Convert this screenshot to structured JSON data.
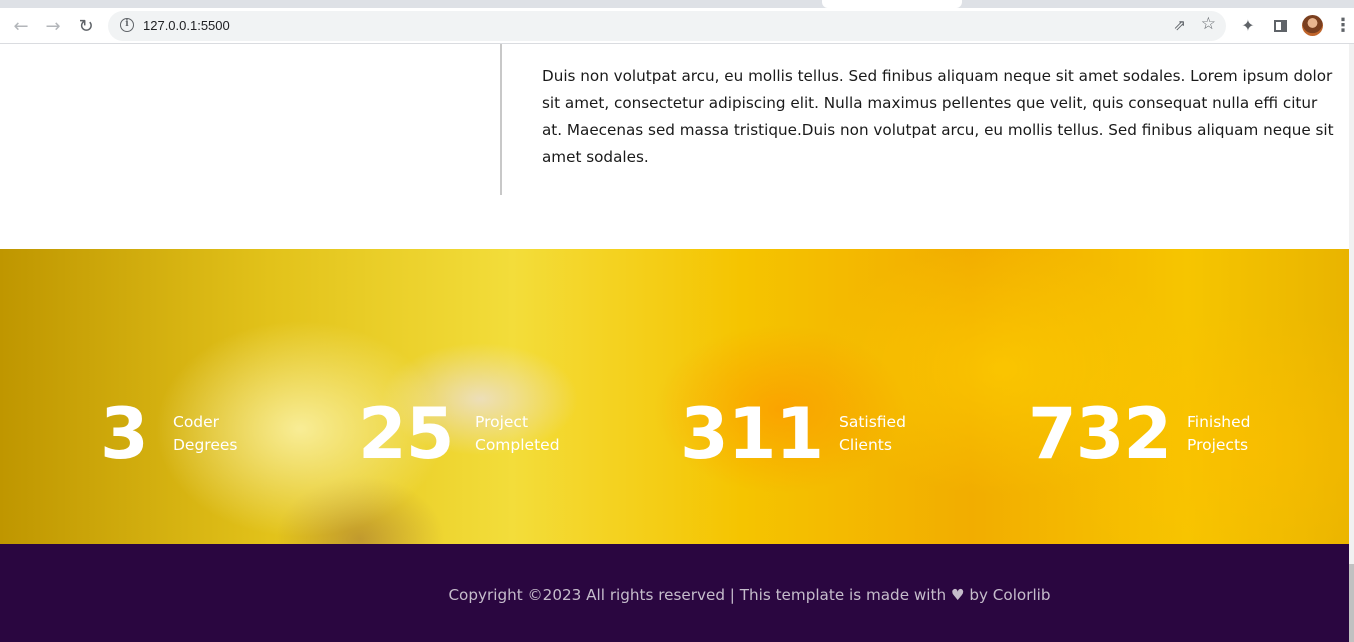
{
  "browser": {
    "url": "127.0.0.1:5500",
    "icons": {
      "back": "arrow-left-icon",
      "forward": "arrow-right-icon",
      "reload": "reload-icon",
      "site_info": "info-icon",
      "share": "share-icon",
      "bookmark": "star-icon",
      "extensions": "puzzle-icon",
      "side_panel": "side-panel-icon",
      "menu": "kebab-menu-icon"
    }
  },
  "about": {
    "paragraph": "Duis non volutpat arcu, eu mollis tellus. Sed finibus aliquam neque sit amet sodales. Lorem ipsum dolor sit amet, consectetur adipiscing elit. Nulla maximus pellentes que velit, quis consequat nulla effi citur at. Maecenas sed massa tristique.Duis non volutpat arcu, eu mollis tellus. Sed finibus aliquam neque sit amet sodales."
  },
  "counters": [
    {
      "number": "3",
      "label_line1": "Coder",
      "label_line2": "Degrees"
    },
    {
      "number": "25",
      "label_line1": "Project",
      "label_line2": "Completed"
    },
    {
      "number": "311",
      "label_line1": "Satisfied",
      "label_line2": "Clients"
    },
    {
      "number": "732",
      "label_line1": "Finished",
      "label_line2": "Projects"
    }
  ],
  "footer": {
    "copyright": "Copyright ©2023 All rights reserved | This template is made with ♥ by Colorlib"
  },
  "colors": {
    "footer_bg": "#2a0640",
    "counter_bg": "#f5c400",
    "text": "#1a1a1a"
  }
}
